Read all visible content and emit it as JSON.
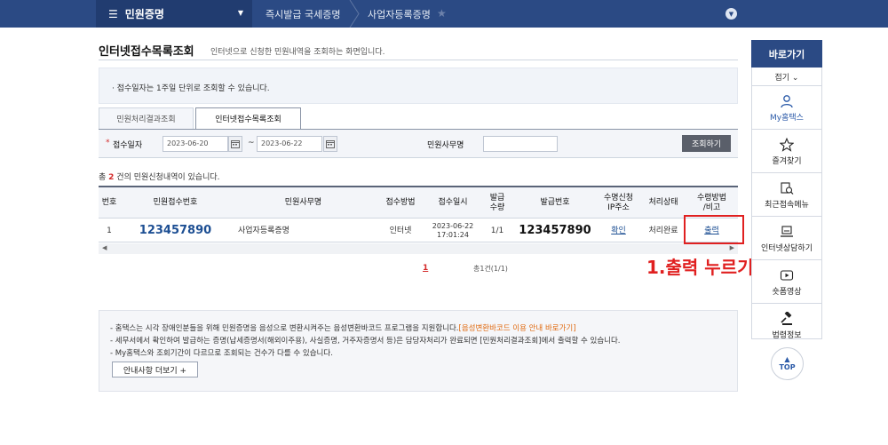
{
  "topnav": {
    "menu_label": "민원증명",
    "crumbs": [
      "즉시발급 국세증명",
      "사업자등록증명"
    ]
  },
  "page": {
    "title": "인터넷접수목록조회",
    "description": "인터넷으로 신청한 민원내역을 조회하는 화면입니다."
  },
  "info": {
    "note": "· 접수일자는 1주일 단위로 조회할 수 있습니다."
  },
  "tabs": [
    {
      "label": "민원처리결과조회"
    },
    {
      "label": "인터넷접수목록조회"
    }
  ],
  "search": {
    "required_mark": "*",
    "date_label": "접수일자",
    "date_from": "2023-06-20",
    "date_to": "2023-06-22",
    "tilde": "~",
    "office_label": "민원사무명",
    "office_value": "",
    "button": "조회하기"
  },
  "result": {
    "prefix": "총 ",
    "count": "2",
    "suffix": " 건의 민원신청내역이 있습니다."
  },
  "table": {
    "headers": [
      "번호",
      "민원접수번호",
      "민원사무명",
      "접수방법",
      "접수일시",
      "발급\n수량",
      "발급번호",
      "수명신청\nIP주소",
      "처리상태",
      "수령방법\n/비고"
    ],
    "rows": [
      {
        "no": "1",
        "receipt_no": "123457890",
        "office": "사업자등록증명",
        "method": "인터넷",
        "date_line1": "2023-06-22",
        "date_line2": "17:01:24",
        "qty": "1/1",
        "issue_no": "123457890",
        "ip": "확인",
        "status": "처리완료",
        "receive": "출력"
      }
    ]
  },
  "annotation": {
    "text": "1.출력 누르기",
    "color": "#e02020"
  },
  "pagination": {
    "current": "1",
    "info": "총1건(1/1)"
  },
  "notice": {
    "line1_a": "- 홈택스는 시각 장애인분들을 위해 민원증명을 음성으로 변환시켜주는 음성변환바코드 프로그램을 지원합니다.",
    "line1_b": "[음성변환바코드 이용 안내 바로가기]",
    "line2": "- 세무서에서 확인하여 발급하는 증명(납세증명서(해외이주용), 사실증명, 거주자증명서 등)은 담당자처리가 완료되면 [민원처리결과조회]에서 출력할 수 있습니다.",
    "line3": "- My홈택스와 조회기간이 다르므로 조회되는 건수가 다를 수 있습니다.",
    "more_button": "안내사항 더보기 +"
  },
  "quick": {
    "title": "바로가기",
    "fold": "접기 ⌄",
    "items": [
      {
        "label": "My홈택스",
        "icon": "person-icon"
      },
      {
        "label": "즐겨찾기",
        "icon": "star-icon"
      },
      {
        "label": "최근접속메뉴",
        "icon": "recent-menu-icon"
      },
      {
        "label": "인터넷상담하기",
        "icon": "consult-icon"
      },
      {
        "label": "숏폼영상",
        "icon": "video-icon"
      },
      {
        "label": "법령정보",
        "icon": "gavel-icon"
      }
    ],
    "top_label": "TOP"
  },
  "colors": {
    "nav": "#2b4a84",
    "accent_red": "#e02020",
    "link_blue": "#1d4f93"
  }
}
